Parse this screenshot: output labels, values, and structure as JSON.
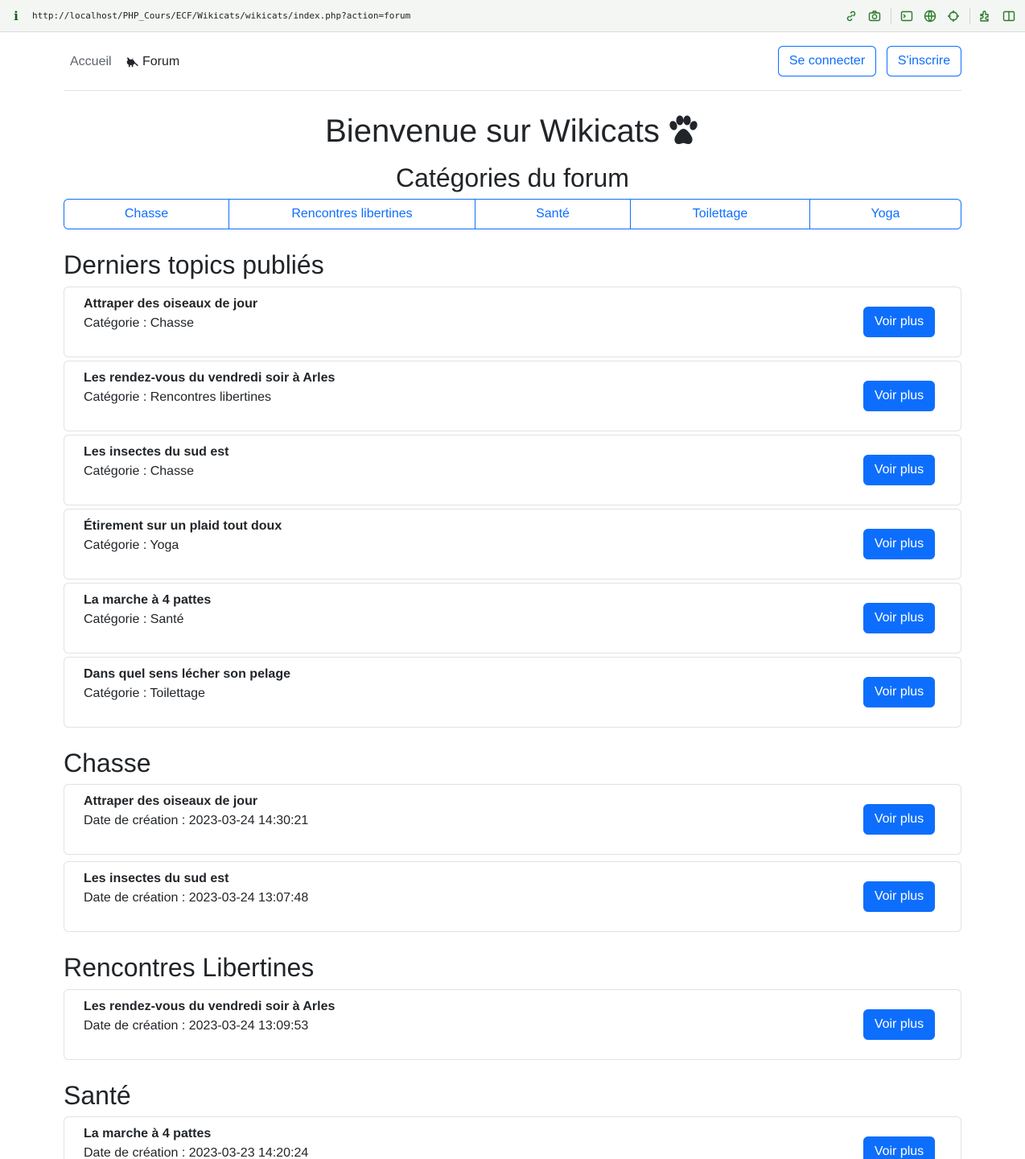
{
  "browser": {
    "url": "http://localhost/PHP_Cours/ECF/Wikicats/wikicats/index.php?action=forum",
    "info_symbol": "i"
  },
  "nav": {
    "home": "Accueil",
    "forum": "Forum",
    "login": "Se connecter",
    "signup": "S'inscrire"
  },
  "page": {
    "title": "Bienvenue sur Wikicats",
    "subtitle": "Catégories du forum"
  },
  "categories": [
    "Chasse",
    "Rencontres libertines",
    "Santé",
    "Toilettage",
    "Yoga"
  ],
  "latest": {
    "heading": "Derniers topics publiés",
    "items": [
      {
        "title": "Attraper des oiseaux de jour",
        "meta": "Catégorie : Chasse",
        "button": "Voir plus"
      },
      {
        "title": "Les rendez-vous du vendredi soir à Arles",
        "meta": "Catégorie : Rencontres libertines",
        "button": "Voir plus"
      },
      {
        "title": "Les insectes du sud est",
        "meta": "Catégorie : Chasse",
        "button": "Voir plus"
      },
      {
        "title": "Étirement sur un plaid tout doux",
        "meta": "Catégorie : Yoga",
        "button": "Voir plus"
      },
      {
        "title": "La marche à 4 pattes",
        "meta": "Catégorie : Santé",
        "button": "Voir plus"
      },
      {
        "title": "Dans quel sens lécher son pelage",
        "meta": "Catégorie : Toilettage",
        "button": "Voir plus"
      }
    ]
  },
  "sections": [
    {
      "heading": "Chasse",
      "items": [
        {
          "title": "Attraper des oiseaux de jour",
          "meta": "Date de création : 2023-03-24 14:30:21",
          "button": "Voir plus"
        },
        {
          "title": "Les insectes du sud est",
          "meta": "Date de création : 2023-03-24 13:07:48",
          "button": "Voir plus"
        }
      ]
    },
    {
      "heading": "Rencontres Libertines",
      "items": [
        {
          "title": "Les rendez-vous du vendredi soir à Arles",
          "meta": "Date de création : 2023-03-24 13:09:53",
          "button": "Voir plus"
        }
      ]
    },
    {
      "heading": "Santé",
      "items": [
        {
          "title": "La marche à 4 pattes",
          "meta": "Date de création : 2023-03-23 14:20:24",
          "button": "Voir plus"
        }
      ]
    }
  ],
  "colors": {
    "primary": "#0d6efd",
    "text": "#212529",
    "muted": "#5c636a",
    "border": "#dee2e6"
  },
  "icons": [
    "info-icon",
    "link-icon",
    "camera-icon",
    "terminal-icon",
    "globe-icon",
    "crosshair-icon",
    "extensions-icon",
    "sidebar-icon",
    "cat-icon",
    "paw-icon"
  ]
}
